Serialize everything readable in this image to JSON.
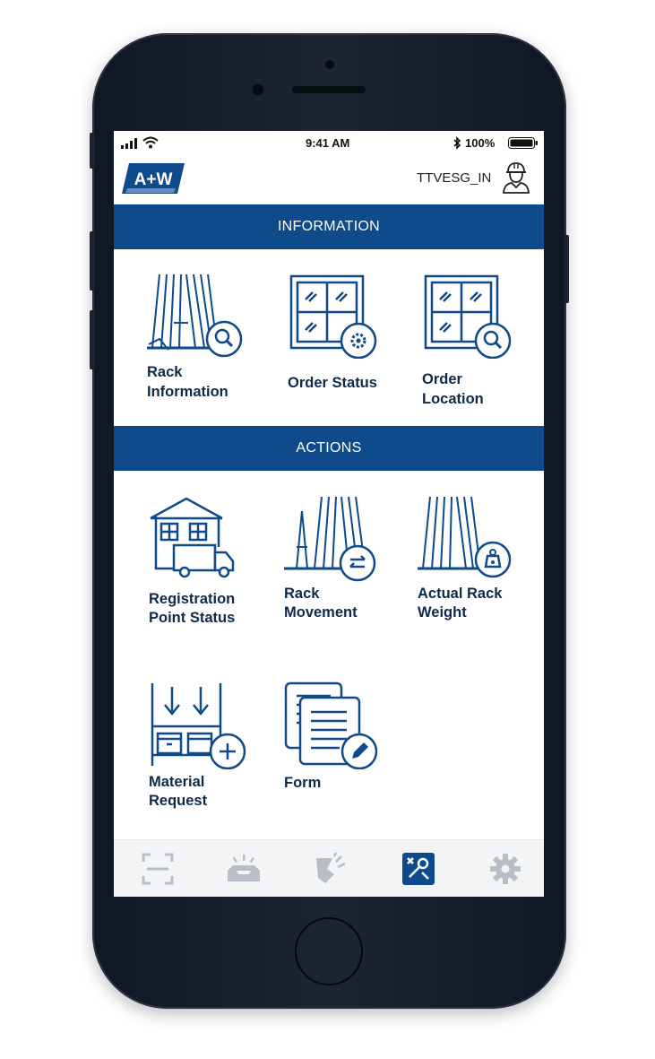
{
  "status_bar": {
    "time": "9:41 AM",
    "battery": "100%"
  },
  "header": {
    "logo_text": "A+W",
    "username": "TTVESG_IN"
  },
  "sections": {
    "information": {
      "title": "INFORMATION",
      "tiles": [
        {
          "label_line1": "Rack",
          "label_line2": "Information",
          "icon": "rack-search-icon"
        },
        {
          "label_line1": "Order Status",
          "label_line2": "",
          "icon": "window-gear-icon"
        },
        {
          "label_line1": "Order",
          "label_line2": "Location",
          "icon": "window-search-icon"
        }
      ]
    },
    "actions": {
      "title": "ACTIONS",
      "tiles": [
        {
          "label_line1": "Registration",
          "label_line2": "Point Status",
          "icon": "house-truck-icon"
        },
        {
          "label_line1": "Rack",
          "label_line2": "Movement",
          "icon": "rack-arrows-icon"
        },
        {
          "label_line1": "Actual Rack",
          "label_line2": "Weight",
          "icon": "rack-weight-icon"
        },
        {
          "label_line1": "Material",
          "label_line2": "Request",
          "icon": "shelf-add-icon"
        },
        {
          "label_line1": "Form",
          "label_line2": "",
          "icon": "form-edit-icon"
        }
      ]
    }
  },
  "tabbar": {
    "tabs": [
      {
        "icon": "scan-icon",
        "active": false
      },
      {
        "icon": "tray-alert-icon",
        "active": false
      },
      {
        "icon": "broken-glass-icon",
        "active": false
      },
      {
        "icon": "tools-icon",
        "active": true
      },
      {
        "icon": "gear-icon",
        "active": false
      }
    ]
  },
  "colors": {
    "primary": "#0f4a8a",
    "icon": "#0f4a8a",
    "inactive_tab": "#b9bec6"
  }
}
